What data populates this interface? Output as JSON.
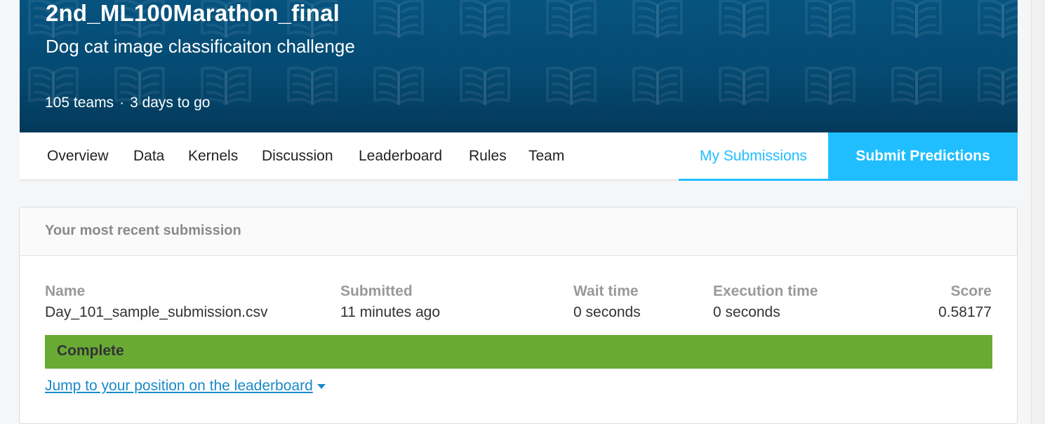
{
  "competition": {
    "title": "2nd_ML100Marathon_final",
    "subtitle": "Dog cat image classificaiton challenge",
    "teams": "105 teams",
    "separator": "·",
    "deadline": "3 days to go"
  },
  "tabs": {
    "overview": "Overview",
    "data": "Data",
    "kernels": "Kernels",
    "discussion": "Discussion",
    "leaderboard": "Leaderboard",
    "rules": "Rules",
    "team": "Team",
    "my_submissions": "My Submissions",
    "submit_predictions": "Submit Predictions"
  },
  "submission": {
    "header": "Your most recent submission",
    "columns": {
      "name": "Name",
      "submitted": "Submitted",
      "wait_time": "Wait time",
      "execution_time": "Execution time",
      "score": "Score"
    },
    "values": {
      "name": "Day_101_sample_submission.csv",
      "submitted": "11 minutes ago",
      "wait_time": "0 seconds",
      "execution_time": "0 seconds",
      "score": "0.58177"
    },
    "status": "Complete",
    "jump_link": "Jump to your position on the leaderboard"
  },
  "colors": {
    "hero_background": "#06537f",
    "accent": "#20beff",
    "status_complete": "#69aa35",
    "link": "#1a8ac9"
  },
  "icons": {
    "hero_pattern": "book-icon",
    "jump_caret": "caret-down-icon"
  }
}
